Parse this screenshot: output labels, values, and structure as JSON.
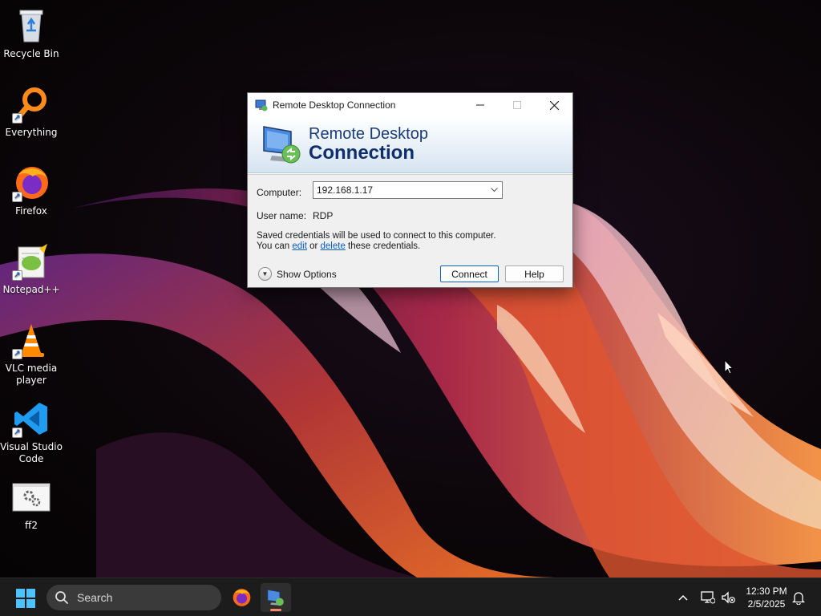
{
  "desktop": {
    "icons": [
      {
        "label": "Recycle Bin"
      },
      {
        "label": "Everything"
      },
      {
        "label": "Firefox"
      },
      {
        "label": "Notepad++"
      },
      {
        "label": "VLC media player"
      },
      {
        "label": "Visual Studio Code"
      },
      {
        "label": "ff2"
      }
    ]
  },
  "rdc": {
    "window_title": "Remote Desktop Connection",
    "banner_line1": "Remote Desktop",
    "banner_line2": "Connection",
    "computer_label": "Computer:",
    "computer_value": "192.168.1.17",
    "username_label": "User name:",
    "username_value": "RDP",
    "cred_line1": "Saved credentials will be used to connect to this computer.",
    "cred_prefix": "You can ",
    "cred_edit": "edit",
    "cred_or": " or ",
    "cred_delete": "delete",
    "cred_suffix": " these credentials.",
    "show_options": "Show Options",
    "connect": "Connect",
    "help": "Help"
  },
  "taskbar": {
    "search_placeholder": "Search",
    "clock_time": "12:30 PM",
    "clock_date": "2/5/2025"
  },
  "colors": {
    "link": "#0a5dc2",
    "banner_text": "#0f2e6e",
    "taskbar_bg": "#1c1c1c",
    "accent_connect": "#0a64c8"
  }
}
